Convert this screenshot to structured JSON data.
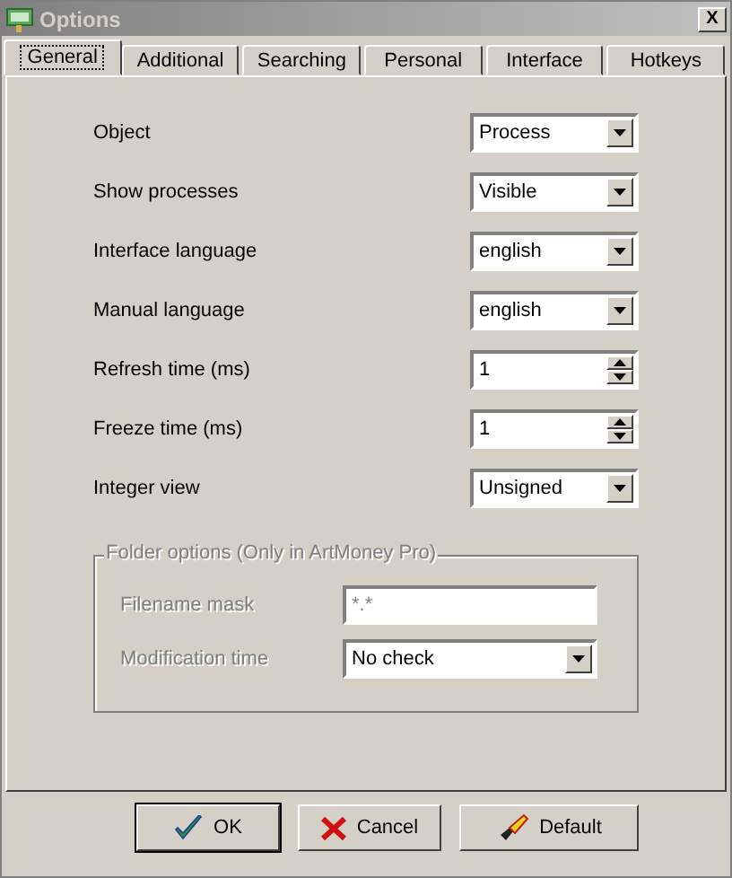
{
  "window": {
    "title": "Options",
    "close": "X"
  },
  "tabs": [
    {
      "label": "General",
      "selected": true
    },
    {
      "label": "Additional",
      "selected": false
    },
    {
      "label": "Searching",
      "selected": false
    },
    {
      "label": "Personal",
      "selected": false
    },
    {
      "label": "Interface",
      "selected": false
    },
    {
      "label": "Hotkeys",
      "selected": false
    }
  ],
  "settings": [
    {
      "label": "Object",
      "kind": "dropdown",
      "value": "Process"
    },
    {
      "label": "Show processes",
      "kind": "dropdown",
      "value": "Visible"
    },
    {
      "label": "Interface language",
      "kind": "dropdown",
      "value": "english"
    },
    {
      "label": "Manual language",
      "kind": "dropdown",
      "value": "english"
    },
    {
      "label": "Refresh time (ms)",
      "kind": "spin",
      "value": "1"
    },
    {
      "label": "Freeze time (ms)",
      "kind": "spin",
      "value": "1"
    },
    {
      "label": "Integer view",
      "kind": "dropdown",
      "value": "Unsigned"
    }
  ],
  "folder_options": {
    "title": "Folder options (Only in ArtMoney Pro)",
    "disabled": true,
    "fields": [
      {
        "label": "Filename mask",
        "kind": "text",
        "value": "*.*"
      },
      {
        "label": "Modification time",
        "kind": "dropdown",
        "value": "No check"
      }
    ]
  },
  "buttons": [
    {
      "label": "OK",
      "kind": "ok"
    },
    {
      "label": "Cancel",
      "kind": "cancel"
    },
    {
      "label": "Default",
      "kind": "default"
    }
  ]
}
